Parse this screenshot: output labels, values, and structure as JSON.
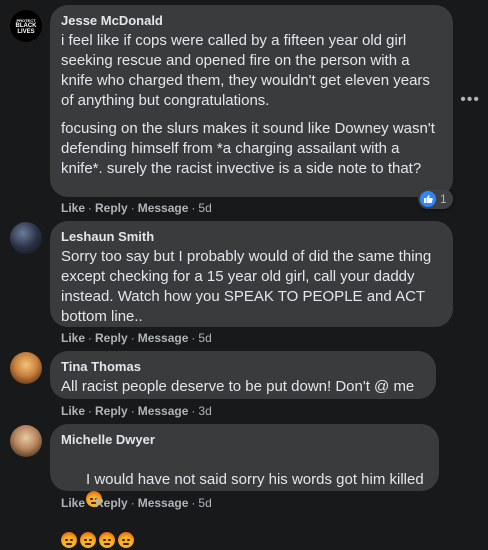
{
  "comments": [
    {
      "author": "Jesse McDonald",
      "avatar_text": [
        "PROTECT",
        "BLACK",
        "LIVES"
      ],
      "paragraphs": [
        "i feel like if cops were called by a fifteen year old girl seeking rescue and opened fire on the person with a knife who charged them, they wouldn't get eleven years of anything but congratulations.",
        "focusing on the slurs makes it sound like Downey wasn't defending himself from *a charging assailant with a knife*. surely the racist invective is a side note to that?"
      ],
      "actions": {
        "like": "Like",
        "reply": "Reply",
        "message": "Message",
        "time": "5d"
      },
      "reactions": {
        "icon": "like-icon",
        "count": "1"
      }
    },
    {
      "author": "Leshaun Smith",
      "text": "Sorry too say but I probably would of did the same thing except checking for a 15 year old girl, call your daddy instead. Watch how you SPEAK TO PEOPLE and ACT bottom line..",
      "actions": {
        "like": "Like",
        "reply": "Reply",
        "message": "Message",
        "time": "5d"
      }
    },
    {
      "author": "Tina Thomas",
      "text": "All racist people deserve to be put down! Don't @ me",
      "actions": {
        "like": "Like",
        "reply": "Reply",
        "message": "Message",
        "time": "3d"
      }
    },
    {
      "author": "Michelle Dwyer",
      "text": "I would have not said sorry his words got him killed",
      "emoji": [
        "angry-face-icon",
        "angry-face-icon",
        "angry-face-icon",
        "angry-face-icon",
        "angry-face-icon"
      ],
      "actions": {
        "like": "Like",
        "reply": "Reply",
        "message": "Message",
        "time": "5d"
      }
    }
  ],
  "more_options_icon": "more-horizontal-icon",
  "colors": {
    "background": "#18191a",
    "bubble": "#3a3b3c",
    "text": "#e4e6eb",
    "meta": "#b0b3b8",
    "like_blue": "#2d88ff"
  }
}
